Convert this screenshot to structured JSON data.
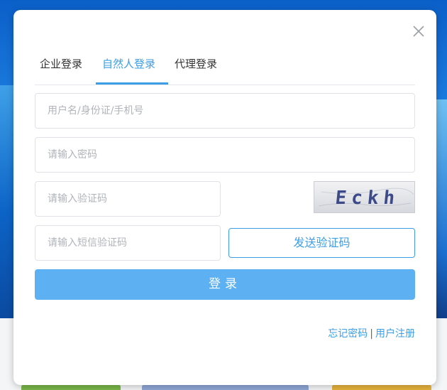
{
  "tabs": [
    {
      "label": "企业登录",
      "active": false
    },
    {
      "label": "自然人登录",
      "active": true
    },
    {
      "label": "代理登录",
      "active": false
    }
  ],
  "form": {
    "username_placeholder": "用户名/身份证/手机号",
    "password_placeholder": "请输入密码",
    "captcha_placeholder": "请输入验证码",
    "sms_placeholder": "请输入短信验证码",
    "captcha_text": "Eckh",
    "send_code_label": "发送验证码",
    "login_label": "登录"
  },
  "footer": {
    "forgot_password": "忘记密码",
    "separator": "|",
    "register": "用户注册"
  },
  "colors": {
    "accent": "#3d9ee6",
    "login_button": "#5db1f2",
    "text": "#333333",
    "placeholder": "#b0b4ba"
  },
  "icons": {
    "close": "close-icon"
  }
}
